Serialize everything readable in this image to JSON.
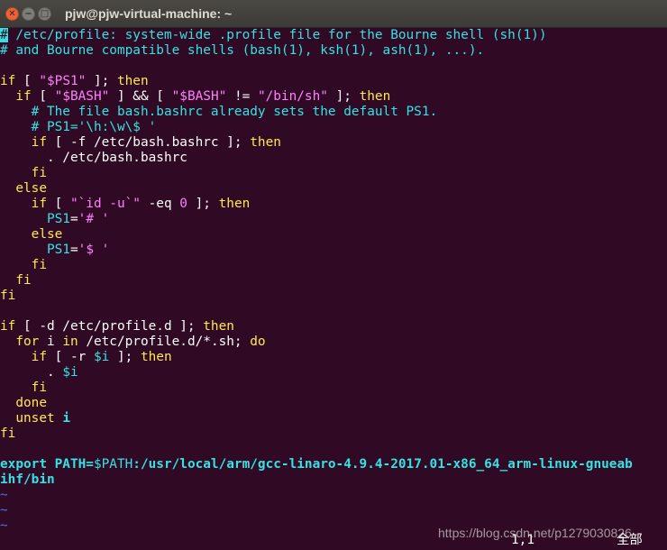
{
  "window": {
    "title": "pjw@pjw-virtual-machine: ~",
    "close_glyph": "✕",
    "minimize_glyph": "−",
    "maximize_glyph": "□"
  },
  "editor": {
    "lines": [
      [
        [
          "c-comment",
          "# /etc/profile: system-wide .profile file for the Bourne shell (sh(1))"
        ]
      ],
      [
        [
          "c-comment",
          "# and Bourne compatible shells (bash(1), ksh(1), ash(1), ...)."
        ]
      ],
      [],
      [
        [
          "c-kw",
          "if"
        ],
        [
          "c-plain",
          " [ "
        ],
        [
          "c-str",
          "\"$PS1\""
        ],
        [
          "c-plain",
          " ]; "
        ],
        [
          "c-kw",
          "then"
        ]
      ],
      [
        [
          "c-plain",
          "  "
        ],
        [
          "c-kw",
          "if"
        ],
        [
          "c-plain",
          " [ "
        ],
        [
          "c-str",
          "\"$BASH\""
        ],
        [
          "c-plain",
          " ] && [ "
        ],
        [
          "c-str",
          "\"$BASH\""
        ],
        [
          "c-plain",
          " != "
        ],
        [
          "c-str",
          "\"/bin/sh\""
        ],
        [
          "c-plain",
          " ]; "
        ],
        [
          "c-kw",
          "then"
        ]
      ],
      [
        [
          "c-comment",
          "    # The file bash.bashrc already sets the default PS1."
        ]
      ],
      [
        [
          "c-comment",
          "    # PS1='\\h:\\w\\$ '"
        ]
      ],
      [
        [
          "c-plain",
          "    "
        ],
        [
          "c-kw",
          "if"
        ],
        [
          "c-plain",
          " [ -f /etc/bash.bashrc ]; "
        ],
        [
          "c-kw",
          "then"
        ]
      ],
      [
        [
          "c-plain",
          "      . /etc/bash.bashrc"
        ]
      ],
      [
        [
          "c-plain",
          "    "
        ],
        [
          "c-kw",
          "fi"
        ]
      ],
      [
        [
          "c-plain",
          "  "
        ],
        [
          "c-kw",
          "else"
        ]
      ],
      [
        [
          "c-plain",
          "    "
        ],
        [
          "c-kw",
          "if"
        ],
        [
          "c-plain",
          " [ "
        ],
        [
          "c-str",
          "\"`id -u`\""
        ],
        [
          "c-plain",
          " -eq "
        ],
        [
          "c-num",
          "0"
        ],
        [
          "c-plain",
          " ]; "
        ],
        [
          "c-kw",
          "then"
        ]
      ],
      [
        [
          "c-plain",
          "      "
        ],
        [
          "c-var",
          "PS1"
        ],
        [
          "c-plain",
          "="
        ],
        [
          "c-str",
          "'# '"
        ]
      ],
      [
        [
          "c-plain",
          "    "
        ],
        [
          "c-kw",
          "else"
        ]
      ],
      [
        [
          "c-plain",
          "      "
        ],
        [
          "c-var",
          "PS1"
        ],
        [
          "c-plain",
          "="
        ],
        [
          "c-str",
          "'$ '"
        ]
      ],
      [
        [
          "c-plain",
          "    "
        ],
        [
          "c-kw",
          "fi"
        ]
      ],
      [
        [
          "c-plain",
          "  "
        ],
        [
          "c-kw",
          "fi"
        ]
      ],
      [
        [
          "c-kw",
          "fi"
        ]
      ],
      [],
      [
        [
          "c-kw",
          "if"
        ],
        [
          "c-plain",
          " [ -d /etc/profile.d ]; "
        ],
        [
          "c-kw",
          "then"
        ]
      ],
      [
        [
          "c-plain",
          "  "
        ],
        [
          "c-kw",
          "for"
        ],
        [
          "c-plain",
          " i "
        ],
        [
          "c-kw",
          "in"
        ],
        [
          "c-plain",
          " /etc/profile.d/*.sh; "
        ],
        [
          "c-kw",
          "do"
        ]
      ],
      [
        [
          "c-plain",
          "    "
        ],
        [
          "c-kw",
          "if"
        ],
        [
          "c-plain",
          " [ -r "
        ],
        [
          "c-var",
          "$i"
        ],
        [
          "c-plain",
          " ]; "
        ],
        [
          "c-kw",
          "then"
        ]
      ],
      [
        [
          "c-plain",
          "      . "
        ],
        [
          "c-var",
          "$i"
        ]
      ],
      [
        [
          "c-plain",
          "    "
        ],
        [
          "c-kw",
          "fi"
        ]
      ],
      [
        [
          "c-plain",
          "  "
        ],
        [
          "c-kw",
          "done"
        ]
      ],
      [
        [
          "c-plain",
          "  "
        ],
        [
          "c-kw",
          "unset"
        ],
        [
          "c-plain",
          " "
        ],
        [
          "c-bold",
          "i"
        ]
      ],
      [
        [
          "c-kw",
          "fi"
        ]
      ],
      [],
      [
        [
          "c-bold",
          "export PATH="
        ],
        [
          "c-var",
          "$PATH"
        ],
        [
          "c-bold",
          ":/usr/local/arm/gcc-linaro-4.9.4-2017.01-x86_64_arm-linux-gnueab"
        ]
      ],
      [
        [
          "c-bold",
          "ihf/bin"
        ]
      ],
      [
        [
          "c-tilde",
          "~"
        ]
      ],
      [
        [
          "c-tilde",
          "~"
        ]
      ],
      [
        [
          "c-tilde",
          "~"
        ]
      ]
    ]
  },
  "status": {
    "position": "1,1",
    "scroll": "全部"
  },
  "watermark": "https://blog.csdn.net/p1279030826",
  "colors": {
    "background": "#300a24",
    "comment": "#34e2e2",
    "keyword": "#fce94f",
    "string": "#ff80ff",
    "tilde": "#5c6bd8"
  }
}
